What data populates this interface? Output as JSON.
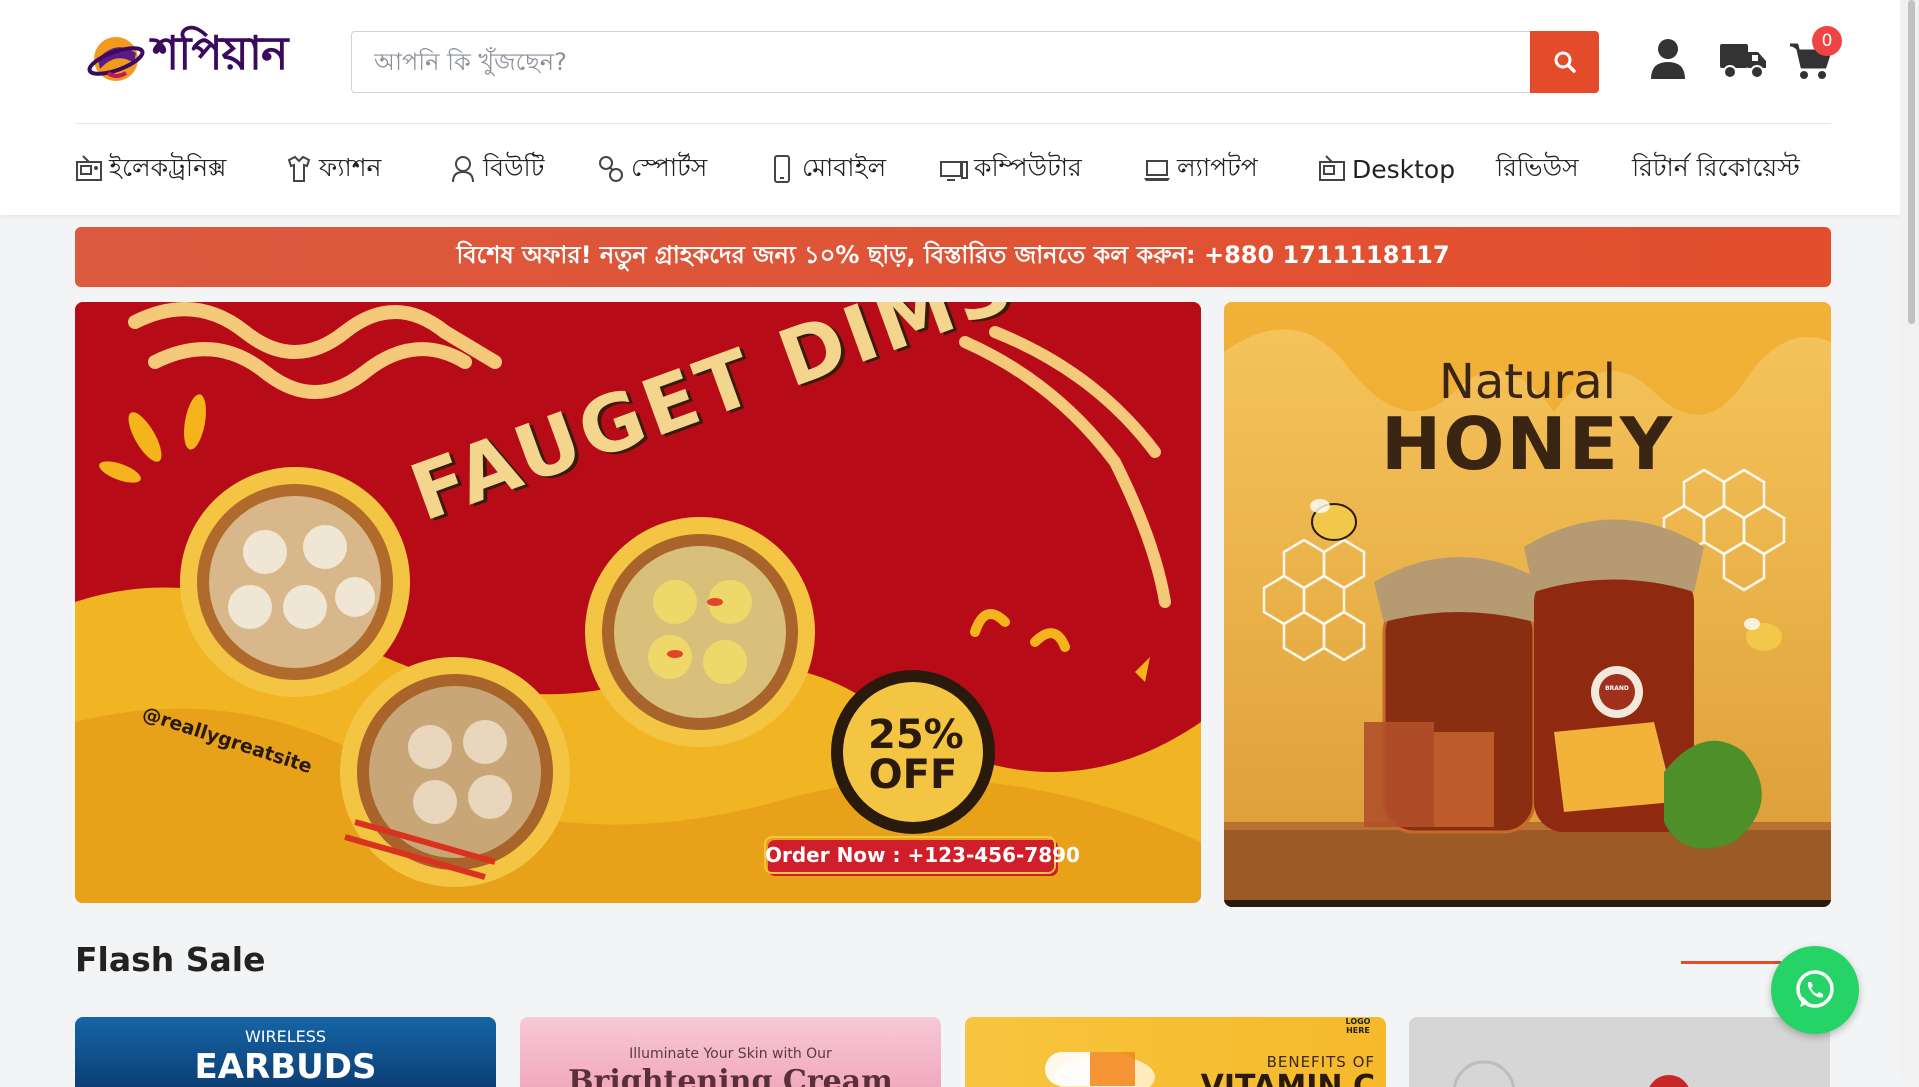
{
  "header": {
    "logo_text": "শপিয়ান",
    "search_placeholder": "আপনি কি খুঁজছেন?",
    "cart_count": "0",
    "icons": [
      "user-icon",
      "truck-icon",
      "cart-icon",
      "search-icon"
    ]
  },
  "nav": {
    "items": [
      {
        "label": "ইলেকট্রনিক্স",
        "icon": "electronics-icon"
      },
      {
        "label": "ফ্যাশন",
        "icon": "fashion-icon"
      },
      {
        "label": "বিউটি",
        "icon": "beauty-icon"
      },
      {
        "label": "স্পোর্টস",
        "icon": "sports-icon"
      },
      {
        "label": "মোবাইল",
        "icon": "mobile-icon"
      },
      {
        "label": "কম্পিউটার",
        "icon": "computer-icon"
      },
      {
        "label": "ল্যাপটপ",
        "icon": "laptop-icon"
      },
      {
        "label": "Desktop",
        "icon": "desktop-icon"
      },
      {
        "label": "রিভিউস",
        "icon": ""
      },
      {
        "label": "রিটার্ন রিকোয়েস্ট",
        "icon": ""
      }
    ]
  },
  "promo": {
    "text": "বিশেষ অফার! নতুন গ্রাহকদের জন্য ১০% ছাড়, বিস্তারিত জানতে কল করুন: +880 1711118117"
  },
  "banner_left": {
    "title": "FAUGET DIMSUM",
    "handle": "@reallygreatsite",
    "discount_number": "25%",
    "discount_word": "OFF",
    "order_text": "Order Now : +123-456-7890"
  },
  "banner_right": {
    "subtitle": "Natural",
    "title": "HONEY",
    "jar_label": "BRAND"
  },
  "flash_sale": {
    "title": "Flash Sale",
    "cards": [
      {
        "top_text": "WIRELESS",
        "main_text": "EARBUDS"
      },
      {
        "top_text": "Illuminate Your Skin with Our",
        "main_text": "Brightening Cream"
      },
      {
        "top_text": "BENEFITS OF",
        "main_text": "VITAMIN C",
        "logo": "LOGO HERE"
      },
      {
        "top_text": "",
        "main_text": ""
      }
    ]
  },
  "colors": {
    "accent": "#e44b2a",
    "whatsapp": "#25d366",
    "badge": "#ef4444"
  }
}
